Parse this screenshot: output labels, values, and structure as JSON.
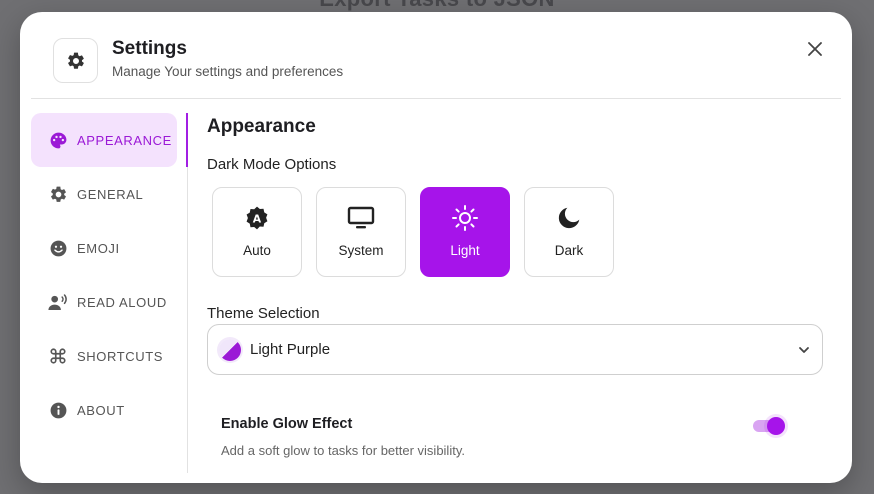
{
  "background": {
    "title": "Export Tasks to JSON"
  },
  "header": {
    "title": "Settings",
    "subtitle": "Manage Your settings and preferences",
    "icon": "gear-icon",
    "close_icon": "close-icon"
  },
  "sidebar": {
    "items": [
      {
        "label": "APPEARANCE",
        "icon": "palette-icon",
        "active": true
      },
      {
        "label": "GENERAL",
        "icon": "gear-icon",
        "active": false
      },
      {
        "label": "EMOJI",
        "icon": "smiley-icon",
        "active": false
      },
      {
        "label": "READ ALOUD",
        "icon": "speaker-person-icon",
        "active": false
      },
      {
        "label": "SHORTCUTS",
        "icon": "command-icon",
        "active": false
      },
      {
        "label": "ABOUT",
        "icon": "info-icon",
        "active": false
      }
    ]
  },
  "main": {
    "section_title": "Appearance",
    "dark_mode_label": "Dark Mode Options",
    "dark_modes": [
      {
        "label": "Auto",
        "icon": "auto-badge-icon",
        "selected": false
      },
      {
        "label": "System",
        "icon": "monitor-icon",
        "selected": false
      },
      {
        "label": "Light",
        "icon": "sun-icon",
        "selected": true
      },
      {
        "label": "Dark",
        "icon": "moon-icon",
        "selected": false
      }
    ],
    "theme_label": "Theme Selection",
    "theme_value": "Light Purple",
    "glow": {
      "title": "Enable Glow Effect",
      "description": "Add a soft glow to tasks for better visibility.",
      "enabled": true
    }
  },
  "colors": {
    "accent": "#a614ea",
    "accent_light": "#f4e2fd",
    "text": "#1e1e22",
    "muted": "#555555"
  }
}
